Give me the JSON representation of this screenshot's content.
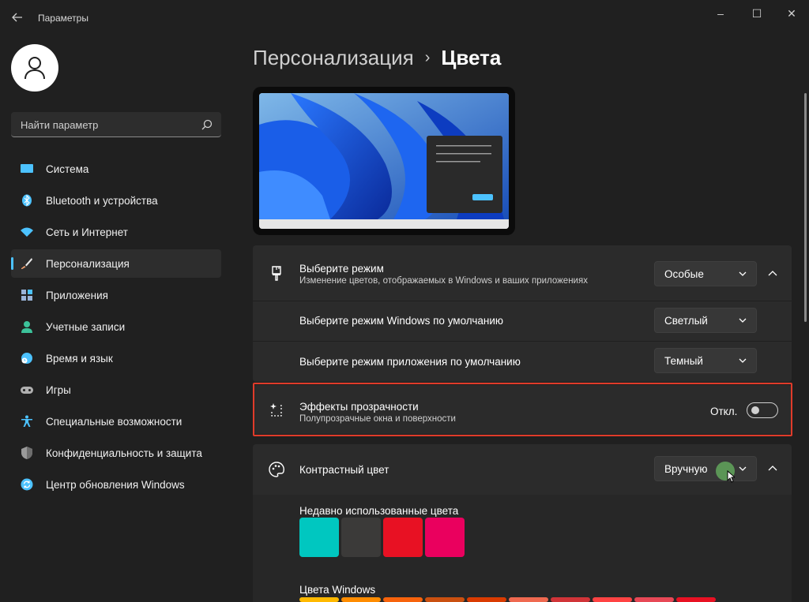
{
  "window": {
    "title": "Параметры",
    "controls": {
      "minimize": "–",
      "maximize": "☐",
      "close": "✕"
    }
  },
  "search": {
    "placeholder": "Найти параметр"
  },
  "sidebar": {
    "items": [
      {
        "label": "Система",
        "icon": "monitor-icon",
        "color": "#4cc2ff"
      },
      {
        "label": "Bluetooth и устройства",
        "icon": "bluetooth-icon",
        "color": "#4cc2ff"
      },
      {
        "label": "Сеть и Интернет",
        "icon": "wifi-icon",
        "color": "#4cc2ff"
      },
      {
        "label": "Персонализация",
        "icon": "brush-icon",
        "color": "#f0a070",
        "active": true
      },
      {
        "label": "Приложения",
        "icon": "apps-icon",
        "color": "#9ab4d8"
      },
      {
        "label": "Учетные записи",
        "icon": "person-icon",
        "color": "#3cc29a"
      },
      {
        "label": "Время и язык",
        "icon": "globe-clock-icon",
        "color": "#4cc2ff"
      },
      {
        "label": "Игры",
        "icon": "gamepad-icon",
        "color": "#b0b0b0"
      },
      {
        "label": "Специальные возможности",
        "icon": "accessibility-icon",
        "color": "#4cc2ff"
      },
      {
        "label": "Конфиденциальность и защита",
        "icon": "shield-icon",
        "color": "#9a9a9a"
      },
      {
        "label": "Центр обновления Windows",
        "icon": "update-icon",
        "color": "#4cc2ff"
      }
    ]
  },
  "breadcrumb": {
    "parent": "Персонализация",
    "separator": "›",
    "current": "Цвета"
  },
  "mode": {
    "title": "Выберите режим",
    "subtitle": "Изменение цветов, отображаемых в Windows и ваших приложениях",
    "value": "Особые",
    "windows_mode": {
      "label": "Выберите режим Windows по умолчанию",
      "value": "Светлый"
    },
    "app_mode": {
      "label": "Выберите режим приложения по умолчанию",
      "value": "Темный"
    }
  },
  "transparency": {
    "title": "Эффекты прозрачности",
    "subtitle": "Полупрозрачные окна и поверхности",
    "state_label": "Откл.",
    "enabled": false
  },
  "accent": {
    "title": "Контрастный цвет",
    "value": "Вручную",
    "recent_label": "Недавно использованные цвета",
    "recent_colors": [
      "#00c7c0",
      "#3b3a39",
      "#e81123",
      "#ea005e"
    ],
    "windows_colors_label": "Цвета Windows",
    "windows_colors": [
      "#ffb900",
      "#ff8c00",
      "#f7630c",
      "#ca5010",
      "#da3b01",
      "#ef6950",
      "#d13438",
      "#ff4343",
      "#e74856",
      "#e81123"
    ]
  },
  "colors": {
    "accent": "#4cc2ff",
    "highlight_border": "#e03b2a",
    "cursor_dot": "#5fa05a"
  }
}
